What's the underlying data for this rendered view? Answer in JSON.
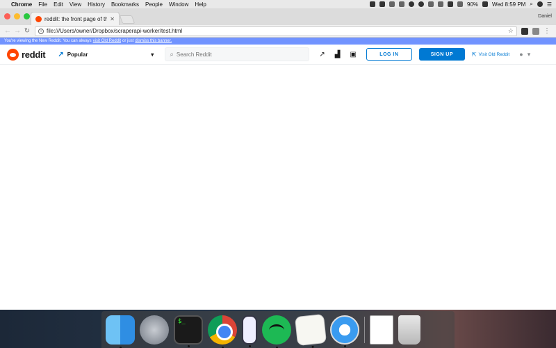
{
  "menubar": {
    "app": "Chrome",
    "menus": [
      "File",
      "Edit",
      "View",
      "History",
      "Bookmarks",
      "People",
      "Window",
      "Help"
    ],
    "battery": "90%",
    "clock": "Wed 8:59 PM"
  },
  "browser": {
    "tab_title": "reddit: the front page of the in",
    "profile_name": "Daniel",
    "url": "file:///Users/owner/Dropbox/scraperapi-worker/test.html"
  },
  "reddit": {
    "banner": {
      "prefix": "You're viewing the New Reddit. You can always",
      "old_link": "visit Old Reddit",
      "middle": "or just",
      "dismiss_link": "dismiss this banner."
    },
    "logo_text": "reddit",
    "feed_label": "Popular",
    "search_placeholder": "Search Reddit",
    "login_label": "LOG IN",
    "signup_label": "SIGN UP",
    "old_reddit_label": "Visit Old Reddit"
  },
  "colors": {
    "reddit_orange": "#ff4500",
    "reddit_blue": "#0079d3",
    "banner_blue": "#7193ff"
  }
}
